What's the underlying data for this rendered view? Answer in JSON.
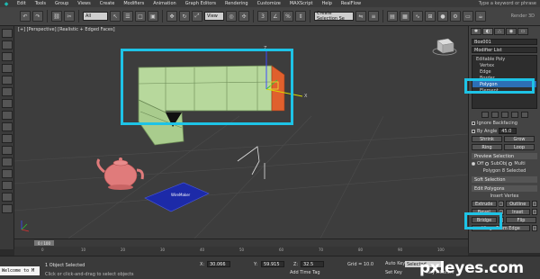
{
  "menubar": {
    "items": [
      "Edit",
      "Tools",
      "Group",
      "Views",
      "Create",
      "Modifiers",
      "Animation",
      "Graph Editors",
      "Rendering",
      "Customize",
      "MAXScript",
      "Help",
      "RealFlow"
    ],
    "right_text": "Type a keyword or phrase"
  },
  "toolbar": {
    "selection_filter": "All",
    "view_dropdown": "View",
    "create_selection_set": "Create Selection Se",
    "render_label": "Render 3D"
  },
  "viewport": {
    "label": "[+] [Perspective] [Realistic + Edged Faces]",
    "plane_label": "WireMaker",
    "gizmo_axis_labels": [
      "Z",
      "X",
      "Y"
    ]
  },
  "command_panel": {
    "object_name": "Box001",
    "modifier_list": "Modifier List",
    "stack_items": [
      {
        "label": "Editable Poly",
        "level": "top",
        "selected": false
      },
      {
        "label": "Vertex",
        "level": "sub",
        "selected": false
      },
      {
        "label": "Edge",
        "level": "sub",
        "selected": false
      },
      {
        "label": "Border",
        "level": "sub",
        "selected": false
      },
      {
        "label": "Polygon",
        "level": "sub",
        "selected": true
      },
      {
        "label": "Element",
        "level": "sub",
        "selected": false
      }
    ],
    "soft_selection_group": "Ignore Backfacing",
    "by_angle_label": "By Angle",
    "by_angle_value": "45.0",
    "shrink": "Shrink",
    "grow": "Grow",
    "ring": "Ring",
    "loop": "Loop",
    "preview_selection": "Preview Selection",
    "preview_off": "Off",
    "preview_subobj": "SubObj",
    "preview_multi": "Multi",
    "selected_count": "Polygon 8 Selected",
    "soft_selection": "Soft Selection",
    "edit_polygons": "Edit Polygons",
    "insert_vertex": "Insert Vertex",
    "extrude": "Extrude",
    "outline": "Outline",
    "bevel": "Bevel",
    "inset": "Inset",
    "bridge": "Bridge",
    "flip": "Flip",
    "hinge": "Hinge From Edge"
  },
  "timeline": {
    "thumb": "0 / 100",
    "ticks": [
      "0",
      "10",
      "20",
      "30",
      "40",
      "50",
      "60",
      "70",
      "80",
      "90",
      "100"
    ]
  },
  "status": {
    "welcome": "Welcome to M",
    "objects_selected": "1 Object Selected",
    "hint": "Click or click-and-drag to select objects",
    "x_label": "X:",
    "x_value": "30.066",
    "y_label": "Y:",
    "y_value": "59.915",
    "z_label": "Z:",
    "z_value": "32.5",
    "grid": "Grid = 10.0",
    "add_time_tag": "Add Time Tag",
    "auto_key": "Auto Key",
    "selected": "Selected",
    "set_key": "Set Key",
    "key_filters": "Key Filters..."
  },
  "watermark": "pxleyes.com",
  "colors": {
    "highlight": "#1ec3e6",
    "box_green": "#b5d79a",
    "teapot": "#e07b7b",
    "plane_blue": "#1c2aa8",
    "selected_face": "#e0602d"
  }
}
